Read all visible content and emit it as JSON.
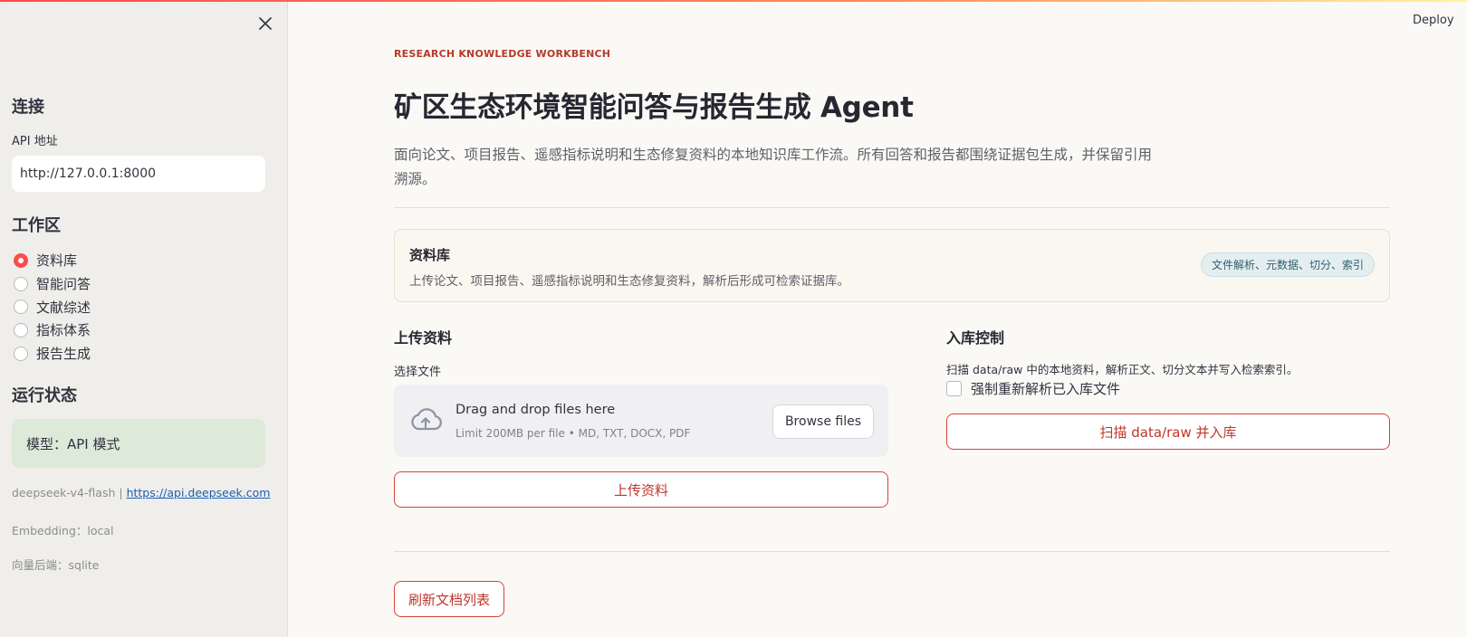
{
  "header": {
    "deploy_label": "Deploy"
  },
  "sidebar": {
    "connection_heading": "连接",
    "api_label": "API 地址",
    "api_value": "http://127.0.0.1:8000",
    "workspace_heading": "工作区",
    "workspace_items": [
      {
        "label": "资料库",
        "selected": true
      },
      {
        "label": "智能问答",
        "selected": false
      },
      {
        "label": "文献综述",
        "selected": false
      },
      {
        "label": "指标体系",
        "selected": false
      },
      {
        "label": "报告生成",
        "selected": false
      }
    ],
    "status_heading": "运行状态",
    "status_box": "模型：API 模式",
    "model_name": "deepseek-v4-flash |",
    "model_url": "https://api.deepseek.com",
    "embedding": "Embedding：local",
    "vector_backend": "向量后端：sqlite"
  },
  "main": {
    "kicker": "RESEARCH KNOWLEDGE WORKBENCH",
    "title": "矿区生态环境智能问答与报告生成 Agent",
    "description": "面向论文、项目报告、遥感指标说明和生态修复资料的本地知识库工作流。所有回答和报告都围绕证据包生成，并保留引用溯源。",
    "card": {
      "title": "资料库",
      "subtitle": "上传论文、项目报告、遥感指标说明和生态修复资料，解析后形成可检索证据库。",
      "pill": "文件解析、元数据、切分、索引"
    },
    "upload": {
      "heading": "上传资料",
      "file_label": "选择文件",
      "drop_main": "Drag and drop files here",
      "drop_sub": "Limit 200MB per file • MD, TXT, DOCX, PDF",
      "browse_label": "Browse files",
      "upload_button": "上传资料"
    },
    "ingest": {
      "heading": "入库控制",
      "description": "扫描 data/raw 中的本地资料，解析正文、切分文本并写入检索索引。",
      "force_reparse_label": "强制重新解析已入库文件",
      "force_reparse_checked": false,
      "scan_button": "扫描 data/raw 并入库"
    },
    "refresh_button": "刷新文档列表"
  },
  "colors": {
    "accent": "#ff4b4b",
    "button_text": "#c0362c",
    "kicker": "#b53a2c",
    "status_green": "#dde9d9",
    "sidebar_bg": "#f0eeea"
  }
}
